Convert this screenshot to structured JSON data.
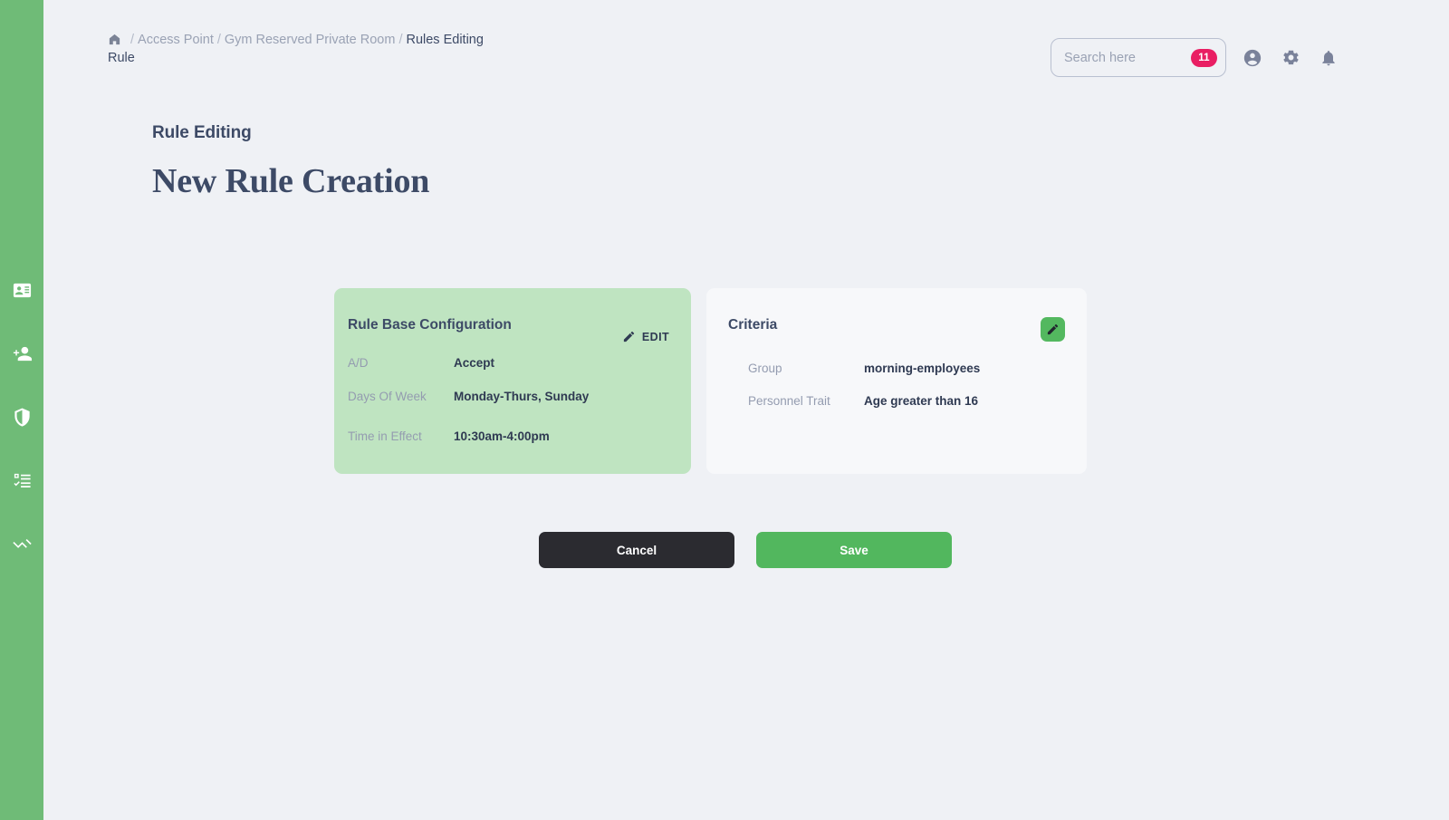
{
  "theme": {
    "sidebar_green": "#6fbb77",
    "page_bg": "#eff1f5",
    "card_green": "#bfe4c1",
    "card_white": "#f7f8fa",
    "accent_green": "#52b75e",
    "badge_pink": "#e91e63",
    "text_dark": "#3d4a66",
    "text_muted": "#949cb0",
    "cancel_dark": "#2b2b30"
  },
  "sidebar": {
    "items": [
      {
        "name": "badge-id-card-icon",
        "label": "Credentials"
      },
      {
        "name": "add-person-icon",
        "label": "Add Personnel"
      },
      {
        "name": "shield-icon",
        "label": "Security"
      },
      {
        "name": "checklist-icon",
        "label": "Rules"
      },
      {
        "name": "analytics-trend-icon",
        "label": "Analytics"
      }
    ]
  },
  "breadcrumb": {
    "home_icon": "home-icon",
    "separator": "/",
    "items": [
      {
        "label": "Access Point",
        "active": false
      },
      {
        "label": "Gym Reserved Private Room",
        "active": false
      },
      {
        "label": "Rules",
        "active": true
      }
    ],
    "subtitle": "Editing Rule"
  },
  "search": {
    "placeholder": "Search here",
    "value": "",
    "badge_count": "11"
  },
  "header_icons": [
    {
      "name": "account-circle-icon",
      "label": "Account"
    },
    {
      "name": "gear-icon",
      "label": "Settings"
    },
    {
      "name": "bell-icon",
      "label": "Notifications"
    }
  ],
  "page": {
    "kicker": "Rule Editing",
    "title": "New Rule Creation"
  },
  "rule_base_card": {
    "title": "Rule Base Configuration",
    "edit_label": "EDIT",
    "edit_icon": "pencil-icon",
    "fields": [
      {
        "label": "A/D",
        "value": "Accept"
      },
      {
        "label": "Days Of Week",
        "value": "Monday-Thurs, Sunday"
      },
      {
        "label": "Time in Effect",
        "value": "10:30am-4:00pm"
      }
    ]
  },
  "criteria_card": {
    "title": "Criteria",
    "edit_icon": "pencil-icon",
    "fields": [
      {
        "label": "Group",
        "value": "morning-employees"
      },
      {
        "label": "Personnel Trait",
        "value": "Age greater than 16"
      }
    ]
  },
  "actions": {
    "cancel_label": "Cancel",
    "save_label": "Save"
  }
}
